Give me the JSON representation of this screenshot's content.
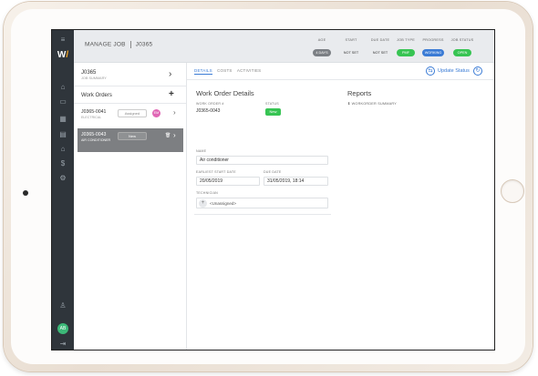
{
  "header": {
    "title": "MANAGE JOB",
    "job_id": "J0365",
    "stats": [
      {
        "label": "AGE",
        "value": "4 DAYS",
        "color": "#7b7f84",
        "text_color": "#ffffff"
      },
      {
        "label": "START",
        "value": "NOT SET",
        "color": "#e9ebee",
        "text_color": "#333333"
      },
      {
        "label": "DUE DATE",
        "value": "NOT SET",
        "color": "#e9ebee",
        "text_color": "#333333"
      },
      {
        "label": "JOB TYPE",
        "value": "PMF",
        "color": "#37c453",
        "text_color": "#ffffff"
      },
      {
        "label": "PROGRESS",
        "value": "WORKING",
        "color": "#3a7bd5",
        "text_color": "#ffffff"
      },
      {
        "label": "JOB STATUS",
        "value": "OPEN",
        "color": "#37c453",
        "text_color": "#ffffff"
      }
    ]
  },
  "left_panel": {
    "job_title": "J0365",
    "job_subtitle": "JOB SUMMARY",
    "work_orders_title": "Work Orders",
    "work_orders": [
      {
        "id": "J0365-0041",
        "type": "ELECTRICAL",
        "status": "Assigned",
        "badge": "EM"
      },
      {
        "id": "J0365-0043",
        "type": "AIR CONDITIONER",
        "status": "New"
      }
    ]
  },
  "main": {
    "tabs": [
      "DETAILS",
      "COSTS",
      "ACTIVITIES"
    ],
    "update_status_label": "Update Status",
    "section_title": "Work Order Details",
    "work_order_label": "WORK ORDER #",
    "work_order_value": "J0365-0043",
    "status_label": "STATUS",
    "status_value": "New",
    "name_label": "NAME",
    "name_value": "Air conditioner",
    "earliest_start_label": "EARLIEST START DATE",
    "earliest_start_value": "20/05/2019",
    "due_date_label": "DUE DATE",
    "due_date_value": "31/05/2019, 18:14",
    "technician_label": "TECHNICIAN",
    "technician_value": "<Unassigned>",
    "reports_title": "Reports",
    "report_item": "WORKORDER SUMMARY"
  },
  "user": {
    "initials": "AB"
  }
}
